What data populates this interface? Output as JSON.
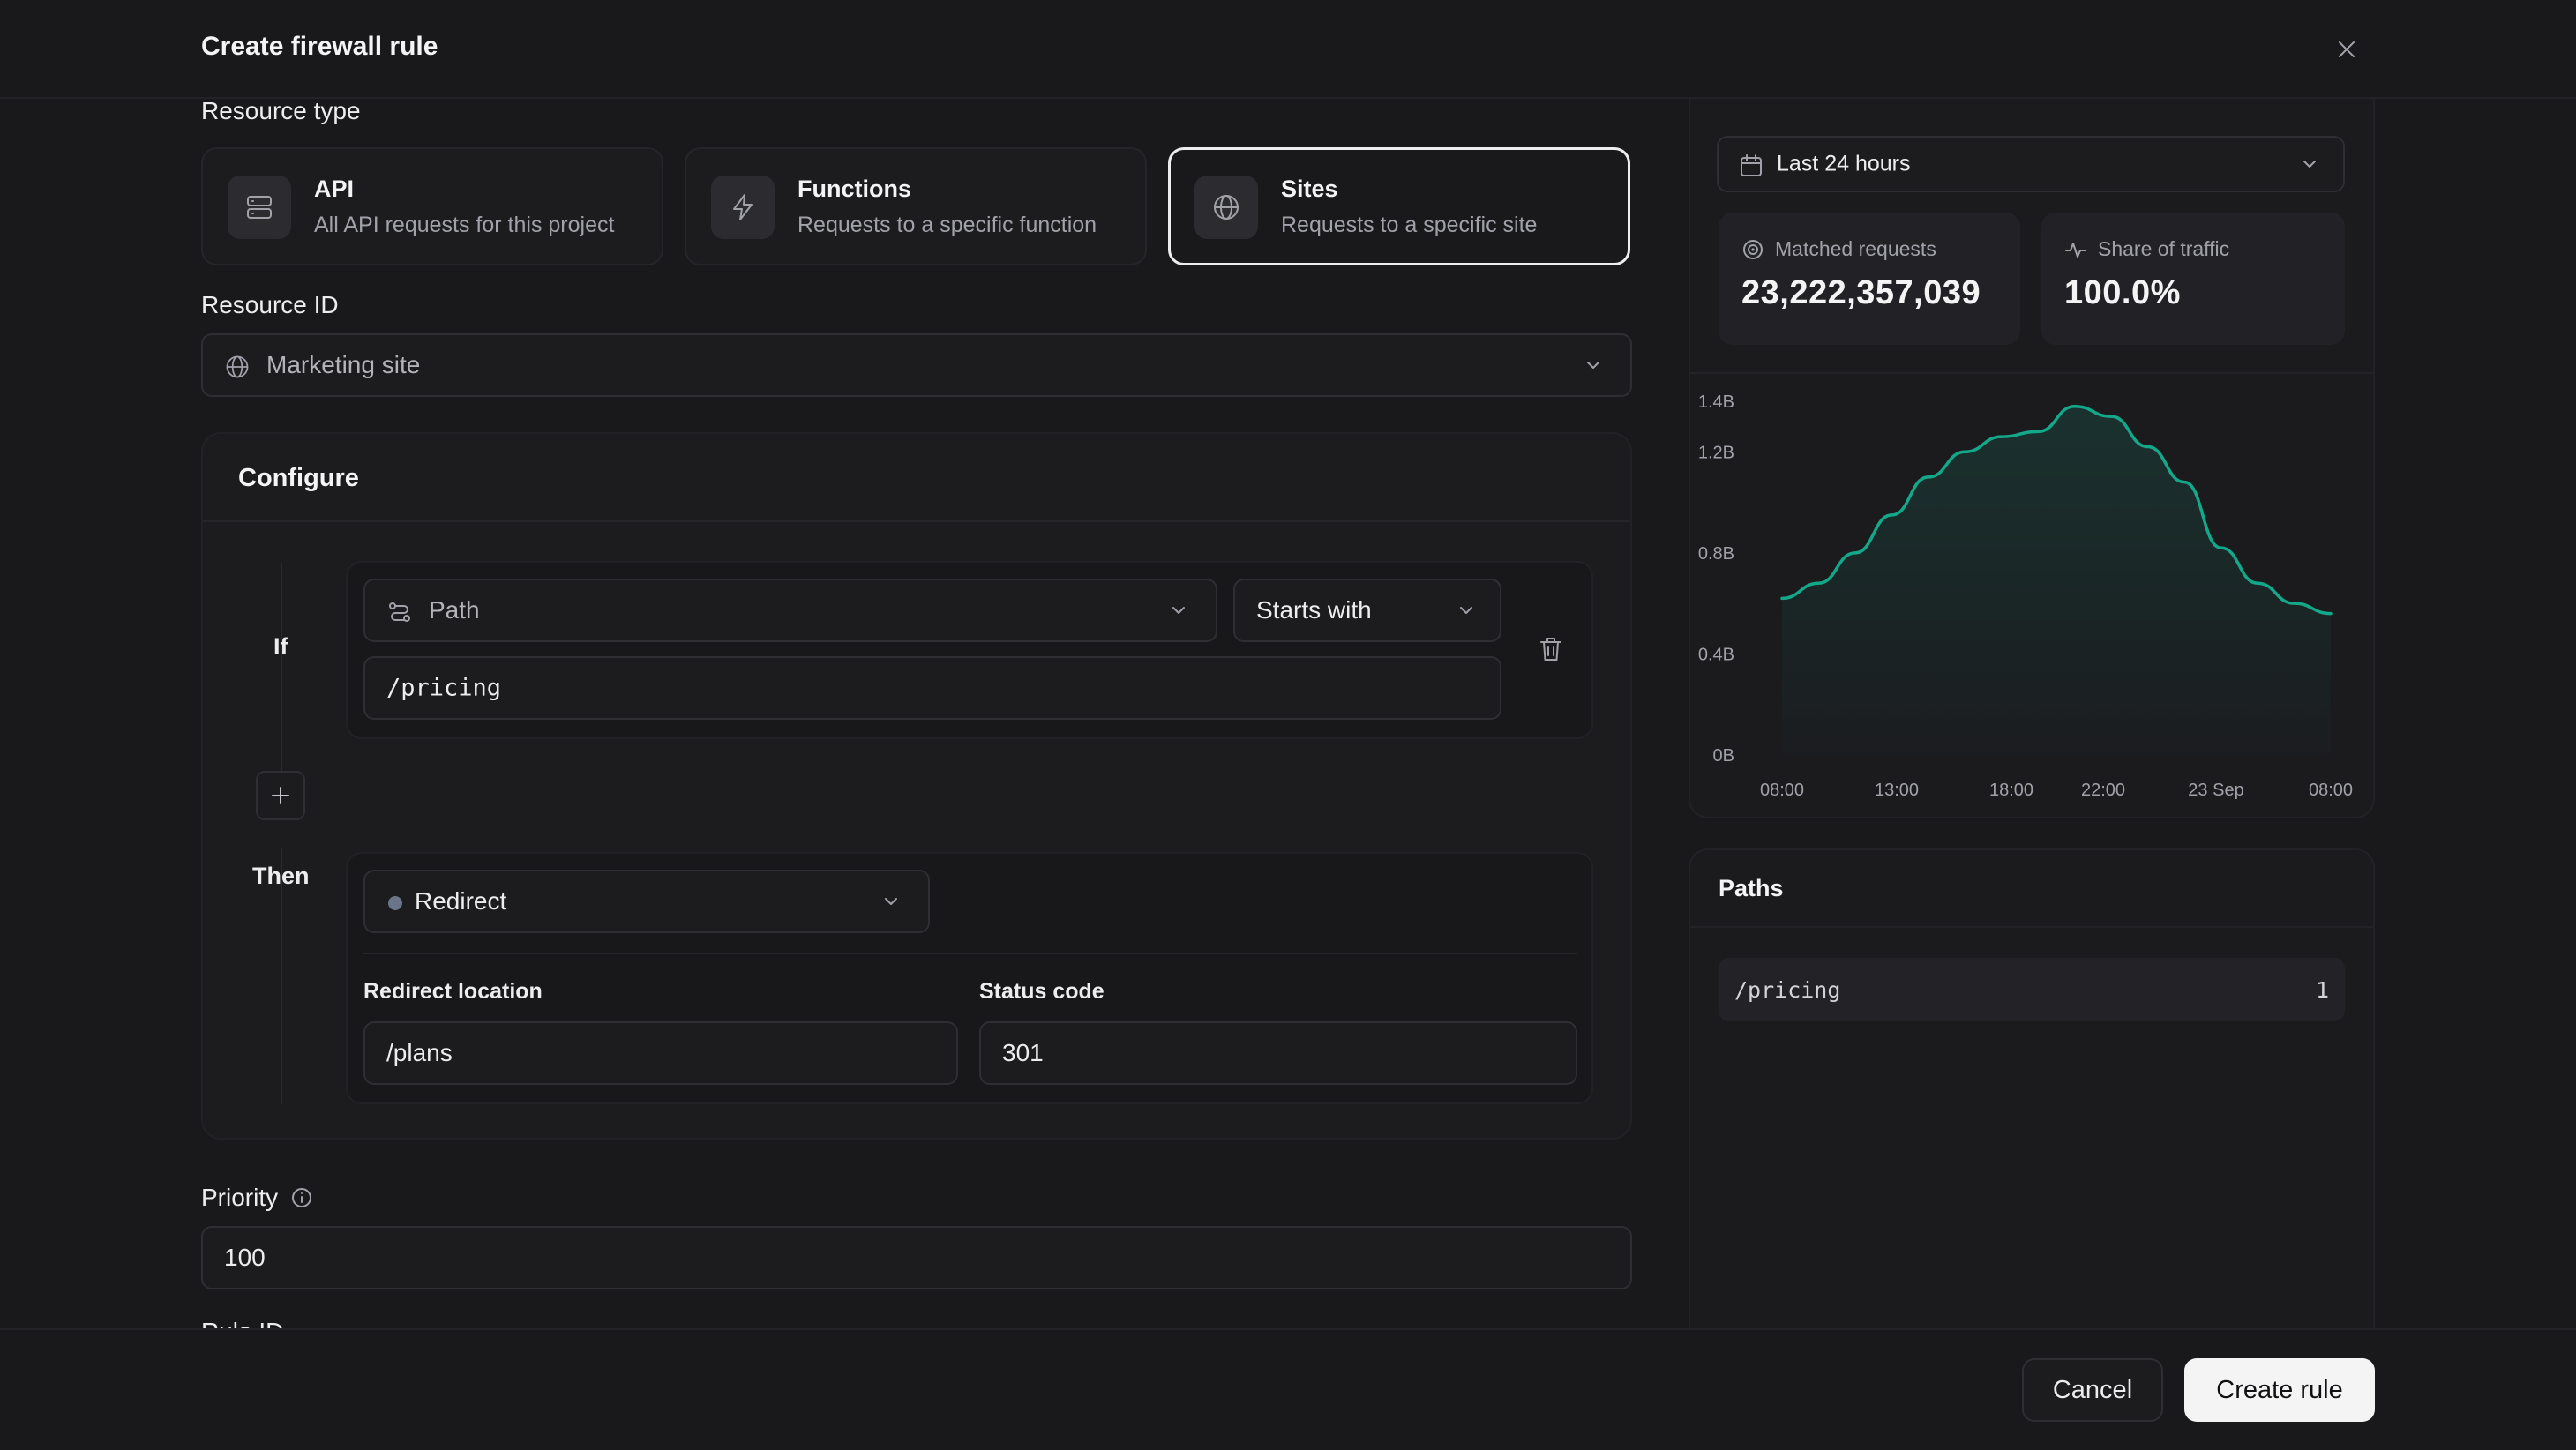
{
  "dialog": {
    "title": "Create firewall rule"
  },
  "resource_type": {
    "label": "Resource type",
    "options": [
      {
        "title": "API",
        "description": "All API requests for this project",
        "icon": "server-icon"
      },
      {
        "title": "Functions",
        "description": "Requests to a specific function",
        "icon": "lightning-icon"
      },
      {
        "title": "Sites",
        "description": "Requests to a specific site",
        "icon": "globe-icon",
        "selected": true
      }
    ]
  },
  "resource_id": {
    "label": "Resource ID",
    "value": "Marketing site"
  },
  "configure": {
    "title": "Configure",
    "if_label": "If",
    "then_label": "Then",
    "condition": {
      "field": "Path",
      "operator": "Starts with",
      "value": "/pricing"
    },
    "action": {
      "value": "Redirect",
      "dot_color": "#6b7589"
    },
    "redirect_location": {
      "label": "Redirect location",
      "value": "/plans"
    },
    "status_code": {
      "label": "Status code",
      "value": "301"
    }
  },
  "priority": {
    "label": "Priority",
    "value": "100"
  },
  "rule_id": {
    "label": "Rule ID"
  },
  "stats": {
    "time_range": "Last 24 hours",
    "matched_requests": {
      "label": "Matched requests",
      "value": "23,222,357,039"
    },
    "share_of_traffic": {
      "label": "Share of traffic",
      "value": "100.0%"
    }
  },
  "chart_data": {
    "type": "area",
    "x": [
      "08:00",
      "10:00",
      "12:00",
      "14:00",
      "16:00",
      "18:00",
      "20:00",
      "21:00",
      "22:00",
      "23:00",
      "00:00",
      "01:00",
      "02:00",
      "04:00",
      "06:00",
      "08:00"
    ],
    "y": [
      0.62,
      0.68,
      0.8,
      0.95,
      1.1,
      1.2,
      1.26,
      1.28,
      1.38,
      1.34,
      1.22,
      1.08,
      0.82,
      0.68,
      0.6,
      0.56
    ],
    "x_tick_labels": [
      "08:00",
      "13:00",
      "18:00",
      "22:00",
      "23 Sep",
      "08:00"
    ],
    "y_tick_labels": [
      "1.4B",
      "1.2B",
      "0.8B",
      "0.4B",
      "0B"
    ],
    "y_ticks": [
      1.4,
      1.2,
      0.8,
      0.4,
      0
    ],
    "ylim": [
      0,
      1.4
    ],
    "line_color": "#14a88a",
    "grid": false
  },
  "paths": {
    "title": "Paths",
    "rows": [
      {
        "path": "/pricing",
        "count": "1"
      }
    ]
  },
  "footer": {
    "cancel": "Cancel",
    "create": "Create rule"
  }
}
